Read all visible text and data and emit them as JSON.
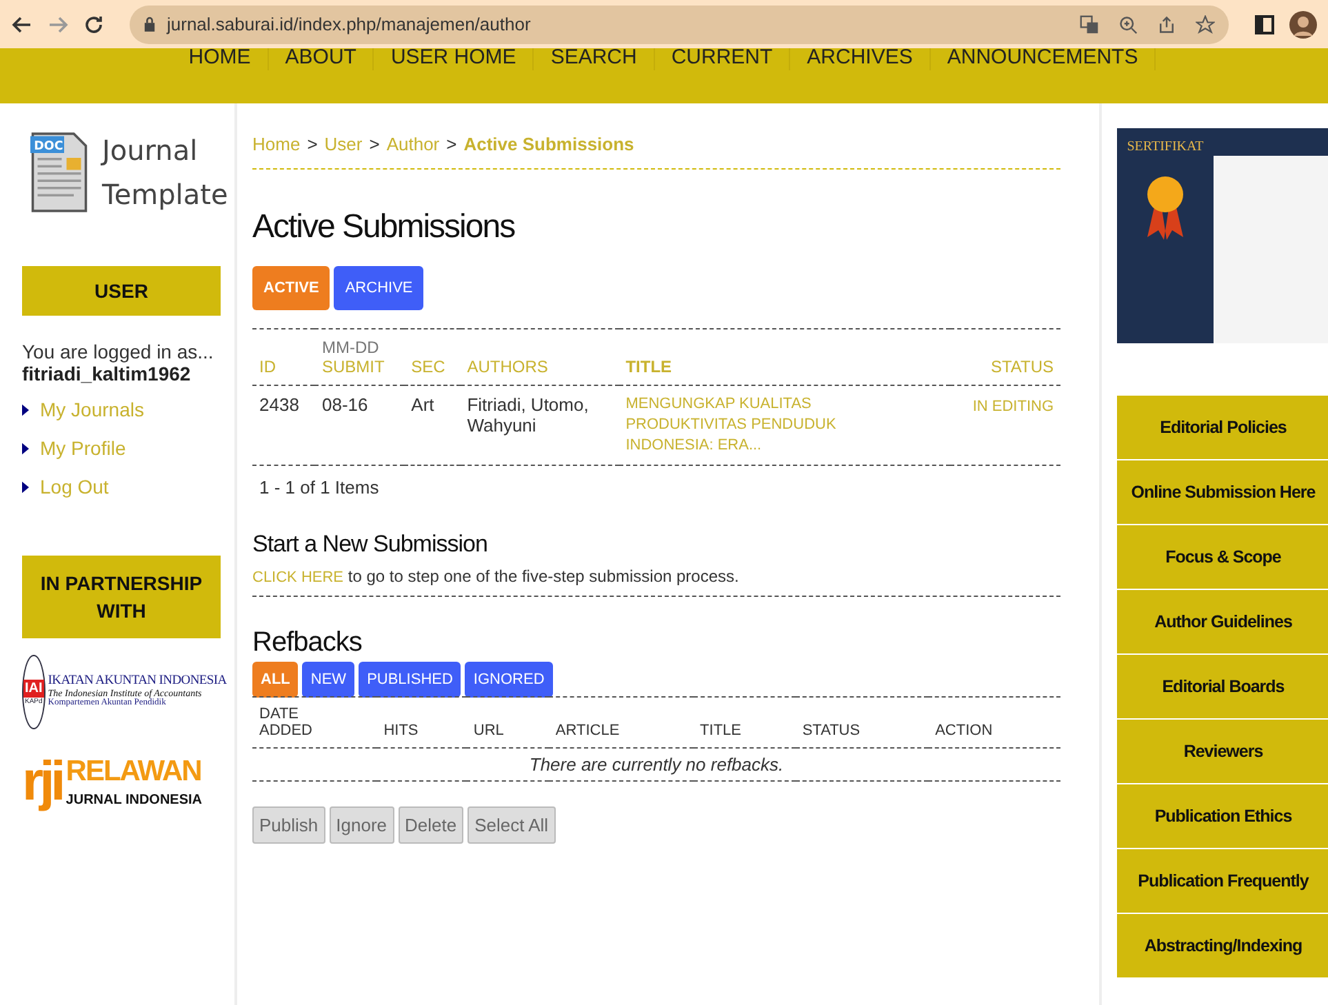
{
  "browser": {
    "url": "jurnal.saburai.id/index.php/manajemen/author"
  },
  "nav": [
    "HOME",
    "ABOUT",
    "USER HOME",
    "SEARCH",
    "CURRENT",
    "ARCHIVES",
    "ANNOUNCEMENTS"
  ],
  "logo": {
    "line1": "Journal",
    "line2": "Template",
    "badge": "DOC"
  },
  "user_block": {
    "heading": "USER",
    "logged_in": "You are logged in as...",
    "username": "fitriadi_kaltim1962",
    "links": [
      "My Journals",
      "My Profile",
      "Log Out"
    ]
  },
  "partnership": {
    "heading": "IN PARTNERSHIP WITH",
    "iai": {
      "mark": "IAI",
      "name": "IKATAN AKUNTAN INDONESIA",
      "english": "The Indonesian Institute of Accountants",
      "sub": "Kompartemen Akuntan Pendidik",
      "code": "KAPd"
    },
    "rji": {
      "mark": "rji",
      "name": "RELAWAN",
      "sub": "JURNAL INDONESIA"
    }
  },
  "breadcrumb": {
    "links": [
      "Home",
      "User",
      "Author"
    ],
    "separator": ">",
    "current": "Active Submissions"
  },
  "page_title": "Active Submissions",
  "tabs": [
    {
      "label": "ACTIVE",
      "selected": true
    },
    {
      "label": "ARCHIVE",
      "selected": false
    }
  ],
  "submissions": {
    "columns": [
      {
        "label": "ID"
      },
      {
        "top": "MM-DD",
        "label": "SUBMIT"
      },
      {
        "label": "SEC"
      },
      {
        "label": "AUTHORS"
      },
      {
        "label": "TITLE"
      },
      {
        "label": "STATUS"
      }
    ],
    "rows": [
      {
        "id": "2438",
        "submit": "08-16",
        "sec": "Art",
        "authors": "Fitriadi, Utomo, Wahyuni",
        "title": "MENGUNGKAP KUALITAS PRODUKTIVITAS PENDUDUK INDONESIA: ERA...",
        "status": "IN EDITING"
      }
    ],
    "count": "1 - 1 of 1 Items"
  },
  "new_submission": {
    "heading": "Start a New Submission",
    "link": "CLICK HERE",
    "text": " to go to step one of the five-step submission process."
  },
  "refbacks": {
    "heading": "Refbacks",
    "filters": [
      {
        "label": "ALL",
        "selected": true
      },
      {
        "label": "NEW",
        "selected": false
      },
      {
        "label": "PUBLISHED",
        "selected": false
      },
      {
        "label": "IGNORED",
        "selected": false
      }
    ],
    "columns": [
      {
        "top": "DATE",
        "label": "ADDED"
      },
      {
        "label": "HITS"
      },
      {
        "label": "URL"
      },
      {
        "label": "ARTICLE"
      },
      {
        "label": "TITLE"
      },
      {
        "label": "STATUS"
      },
      {
        "label": "ACTION"
      }
    ],
    "empty": "There are currently no refbacks.",
    "buttons": [
      "Publish",
      "Ignore",
      "Delete",
      "Select All"
    ]
  },
  "certificate": {
    "title": "SERTIFIKAT"
  },
  "side_menu": [
    "Editorial Policies",
    "Online Submission Here",
    "Focus & Scope",
    "Author Guidelines",
    "Editorial Boards",
    "Reviewers",
    "Publication Ethics",
    "Publication Frequently",
    "Abstracting/Indexing"
  ]
}
